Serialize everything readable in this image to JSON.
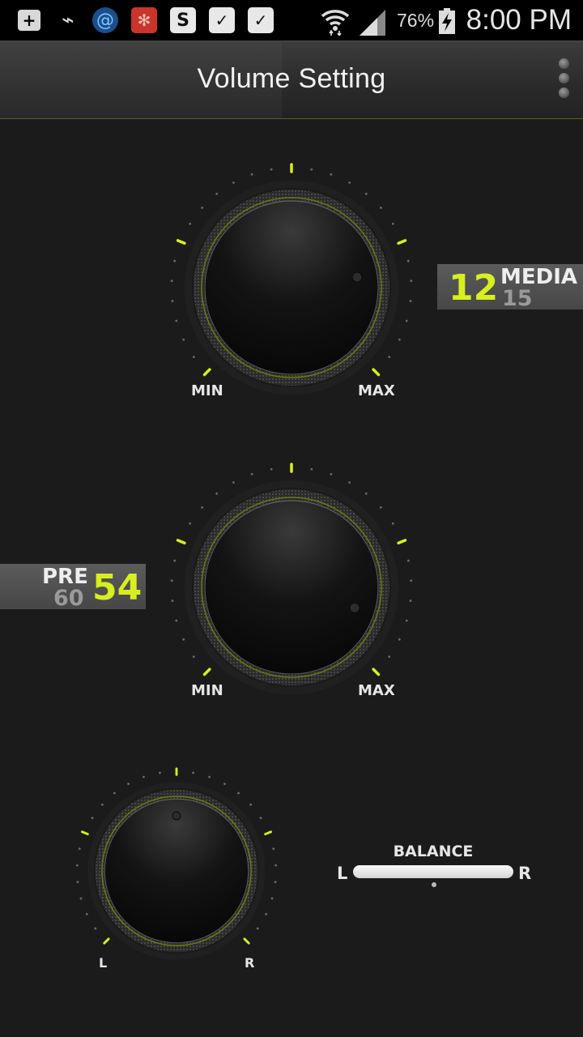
{
  "status_bar": {
    "time": "8:00 PM",
    "battery": "76%",
    "icons": [
      "add-icon",
      "usb-icon",
      "swirl-app-icon",
      "red-app-icon",
      "s-app-icon",
      "shopping-bag-check-icon",
      "shopping-bag-check-icon",
      "wifi-icon",
      "signal-icon",
      "battery-charging-icon"
    ]
  },
  "title_bar": {
    "title": "Volume Setting",
    "menu_icon": "overflow-menu-icon"
  },
  "media_knob": {
    "min_label": "MIN",
    "max_label": "MAX",
    "value": "12",
    "name": "MEDIA",
    "max_value": "15",
    "level": 0.8
  },
  "pre_knob": {
    "min_label": "MIN",
    "max_label": "MAX",
    "value": "54",
    "name": "PRE",
    "max_value": "60",
    "level": 0.9
  },
  "balance_knob": {
    "left_label": "L",
    "right_label": "R",
    "level": 0.5
  },
  "balance_slider": {
    "title": "BALANCE",
    "left_label": "L",
    "right_label": "R",
    "position": 0.5
  },
  "colors": {
    "accent": "#d7ef1d",
    "background": "#1b1b1b",
    "panel": "#505050"
  }
}
